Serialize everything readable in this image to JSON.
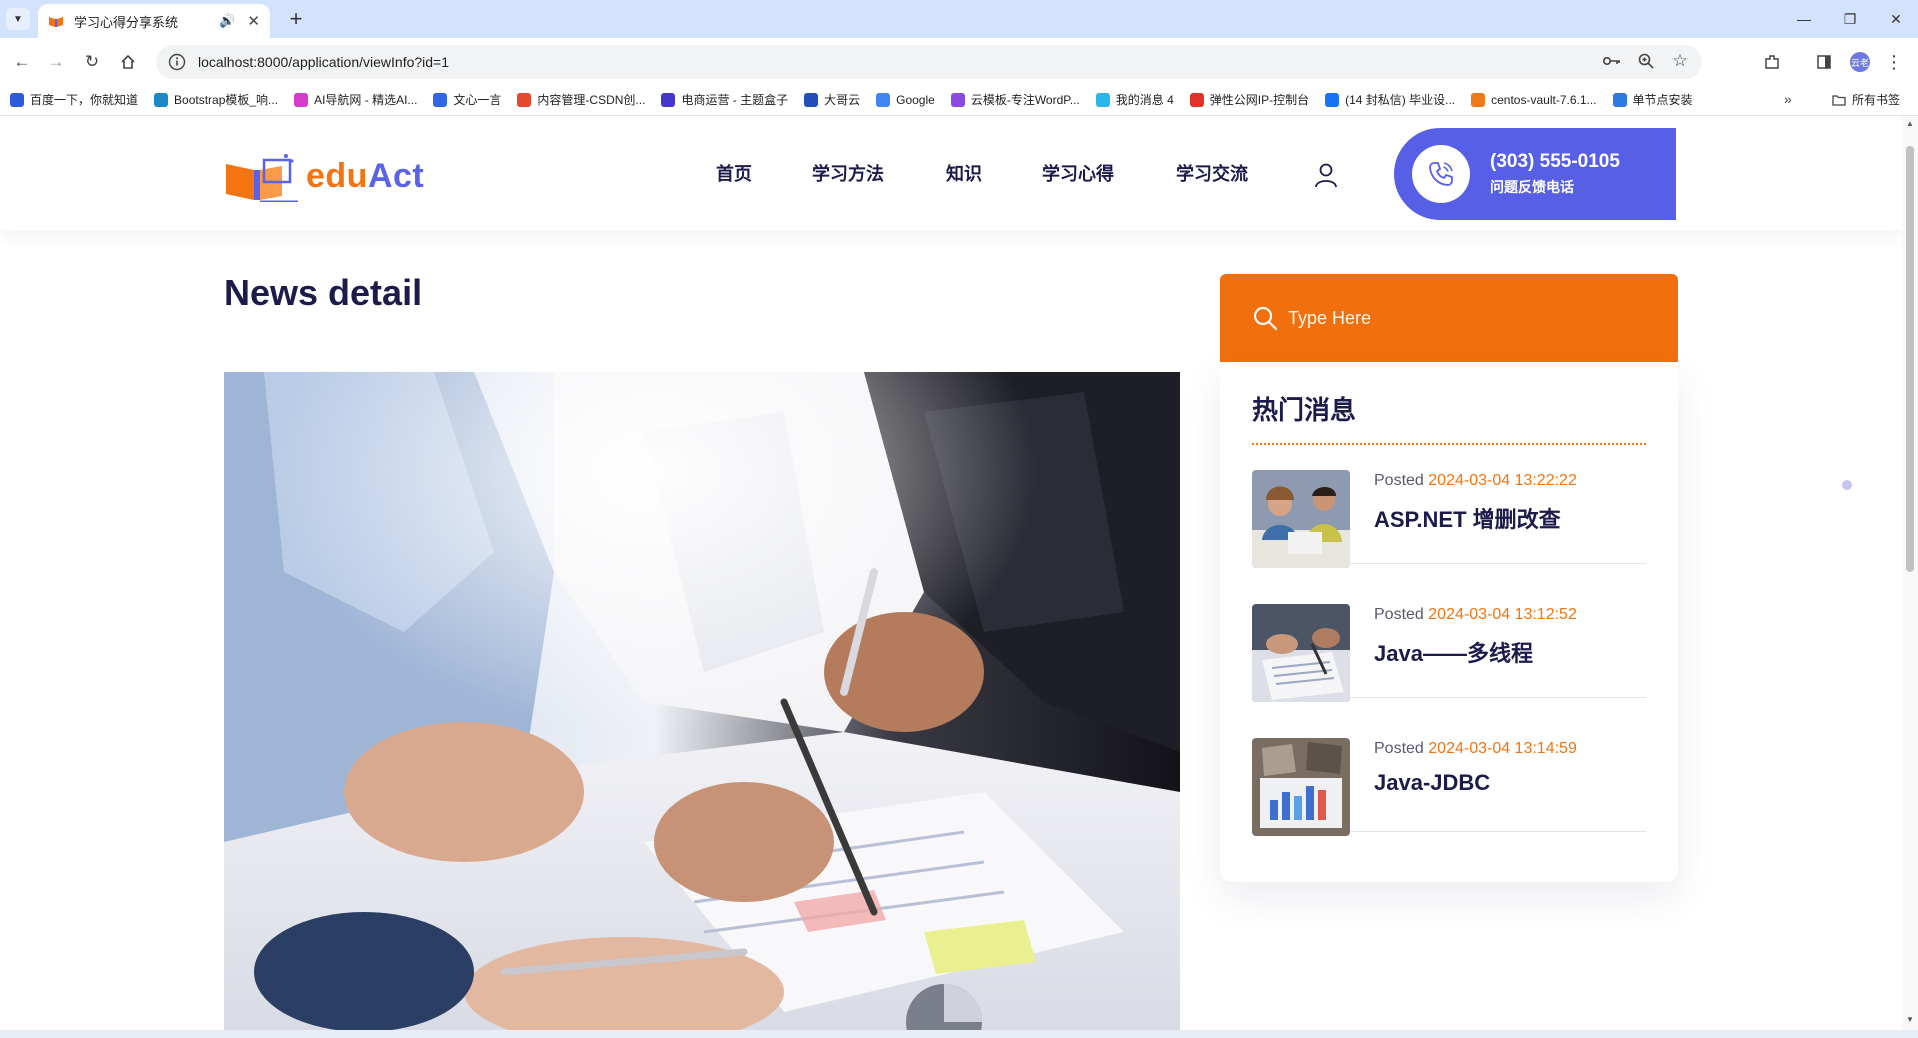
{
  "browser": {
    "tab_title": "学习心得分享系统",
    "url": "localhost:8000/application/viewInfo?id=1",
    "bookmarks": [
      {
        "label": "百度一下，你就知道",
        "color": "#2e5bd8"
      },
      {
        "label": "Bootstrap模板_响...",
        "color": "#1e88c7"
      },
      {
        "label": "AI导航网 - 精选AI...",
        "color": "#d63cc9"
      },
      {
        "label": "文心一言",
        "color": "#3167e5"
      },
      {
        "label": "内容管理-CSDN创...",
        "color": "#e2492f"
      },
      {
        "label": "电商运营 - 主题盒子",
        "color": "#4537c9"
      },
      {
        "label": "大哥云",
        "color": "#2350b8"
      },
      {
        "label": "Google",
        "color": "#4285f4"
      },
      {
        "label": "云模板-专注WordP...",
        "color": "#8a4be0"
      },
      {
        "label": "我的消息 4",
        "color": "#2ab6e8"
      },
      {
        "label": "弹性公网IP-控制台",
        "color": "#e0322b"
      },
      {
        "label": "(14 封私信) 毕业设...",
        "color": "#1772f6"
      },
      {
        "label": "centos-vault-7.6.1...",
        "color": "#f07a18"
      },
      {
        "label": "单节点安装",
        "color": "#2e7be0"
      }
    ],
    "all_bookmarks_label": "所有书签",
    "profile_initial": "云老"
  },
  "header": {
    "logo_edu": "edu",
    "logo_act": "Act",
    "nav": [
      "首页",
      "学习方法",
      "知识",
      "学习心得",
      "学习交流"
    ],
    "hotline_phone": "(303) 555-0105",
    "hotline_label": "问题反馈电话"
  },
  "main": {
    "title": "News detail"
  },
  "sidebar": {
    "search_placeholder": "Type Here",
    "hot_title": "热门消息",
    "posted_label": "Posted",
    "posts": [
      {
        "date": "2024-03-04 13:22:22",
        "title": "ASP.NET 增删改查"
      },
      {
        "date": "2024-03-04 13:12:52",
        "title": "Java——多线程"
      },
      {
        "date": "2024-03-04 13:14:59",
        "title": "Java-JDBC"
      }
    ]
  },
  "colors": {
    "accent_orange": "#f37410",
    "accent_blue": "#565fe5",
    "heading": "#1d1b4c"
  }
}
